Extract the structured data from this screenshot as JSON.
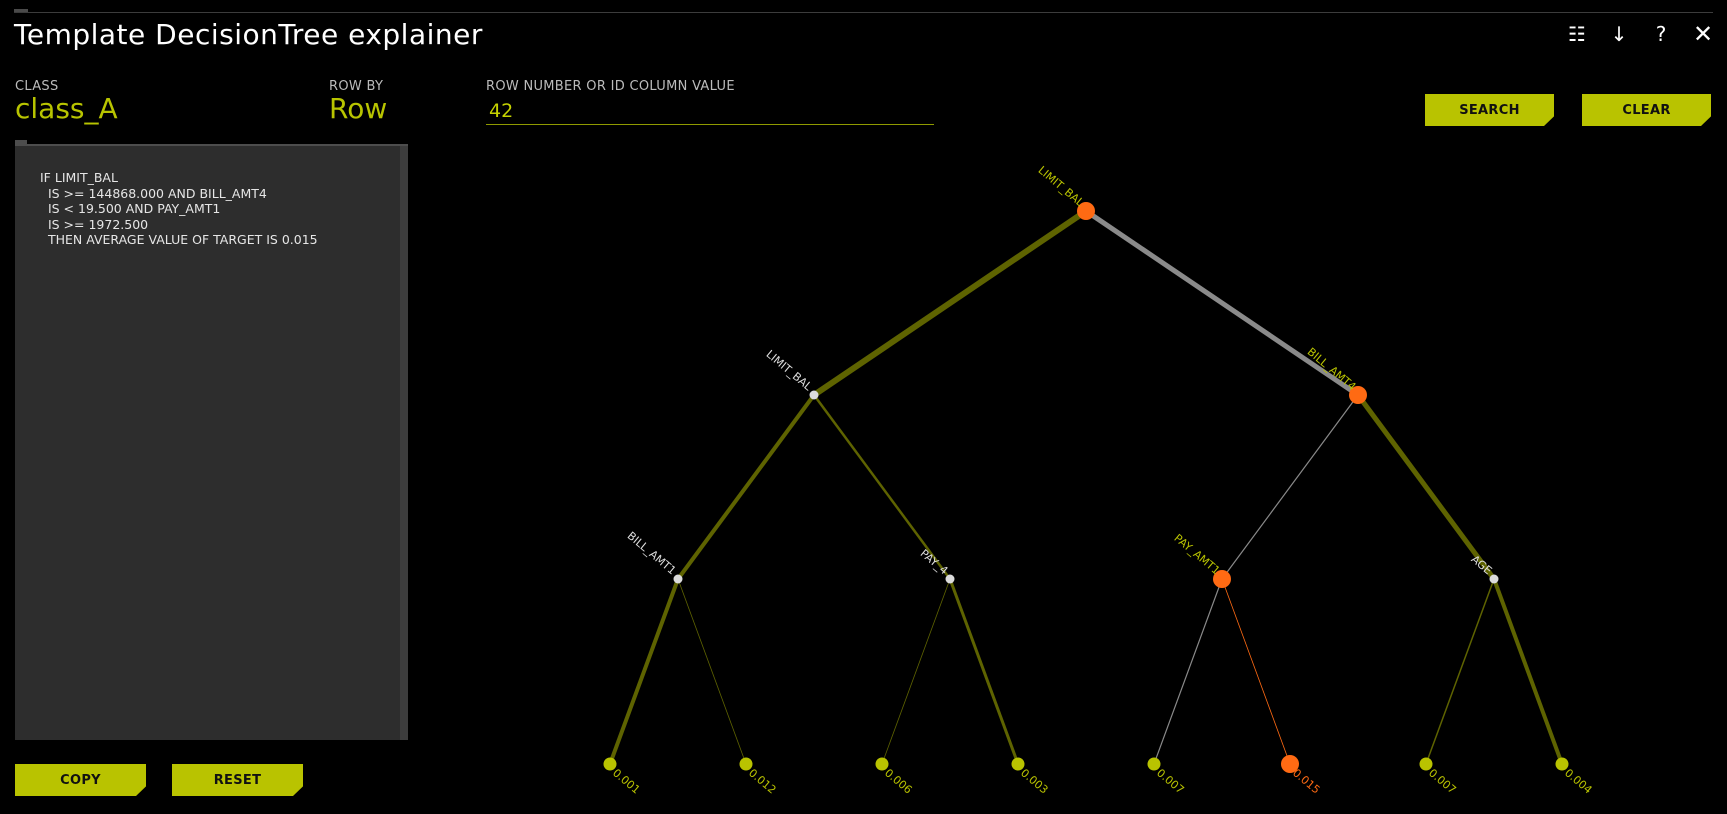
{
  "app": {
    "title": "Template DecisionTree explainer"
  },
  "toolbar": {
    "list_icon": "☷",
    "download_icon": "↓",
    "help_icon": "?",
    "close_icon": "✕"
  },
  "fields": {
    "class_label": "CLASS",
    "class_value": "class_A",
    "rowby_label": "ROW BY",
    "rowby_value": "Row",
    "row_label": "ROW NUMBER OR ID COLUMN VALUE",
    "row_value": "42"
  },
  "buttons": {
    "search": "SEARCH",
    "clear": "CLEAR",
    "copy": "COPY",
    "reset": "RESET"
  },
  "rules_text": "IF LIMIT_BAL\n  IS >= 144868.000 AND BILL_AMT4\n  IS < 19.500 AND PAY_AMT1\n  IS >= 1972.500\n  THEN AVERAGE VALUE OF TARGET IS 0.015",
  "colors": {
    "accent": "#b9c300",
    "path_highlight": "#ff6a13",
    "edge_dark": "#5e6300",
    "edge_gray": "#8a8a8a",
    "node_white": "#dcdcdc"
  },
  "tree": {
    "nodes": [
      {
        "id": "n0",
        "label": "LIMIT_BAL",
        "depth": 0,
        "pos": 0,
        "kind": "split",
        "highlight": true
      },
      {
        "id": "n1",
        "label": "LIMIT_BAL",
        "depth": 1,
        "pos": 0,
        "kind": "split",
        "highlight": false
      },
      {
        "id": "n2",
        "label": "BILL_AMT4",
        "depth": 1,
        "pos": 1,
        "kind": "split",
        "highlight": true
      },
      {
        "id": "n3",
        "label": "BILL_AMT1",
        "depth": 2,
        "pos": 0,
        "kind": "split",
        "highlight": false
      },
      {
        "id": "n4",
        "label": "PAY_4",
        "depth": 2,
        "pos": 1,
        "kind": "split",
        "highlight": false
      },
      {
        "id": "n5",
        "label": "PAY_AMT1",
        "depth": 2,
        "pos": 2,
        "kind": "split",
        "highlight": true
      },
      {
        "id": "n6",
        "label": "AGE",
        "depth": 2,
        "pos": 3,
        "kind": "split",
        "highlight": false
      },
      {
        "id": "l0",
        "label": "0.001",
        "depth": 3,
        "pos": 0,
        "kind": "leaf",
        "highlight": false
      },
      {
        "id": "l1",
        "label": "0.012",
        "depth": 3,
        "pos": 1,
        "kind": "leaf",
        "highlight": false
      },
      {
        "id": "l2",
        "label": "0.006",
        "depth": 3,
        "pos": 2,
        "kind": "leaf",
        "highlight": false
      },
      {
        "id": "l3",
        "label": "0.003",
        "depth": 3,
        "pos": 3,
        "kind": "leaf",
        "highlight": false
      },
      {
        "id": "l4",
        "label": "0.007",
        "depth": 3,
        "pos": 4,
        "kind": "leaf",
        "highlight": false
      },
      {
        "id": "l5",
        "label": "0.015",
        "depth": 3,
        "pos": 5,
        "kind": "leaf",
        "highlight": true
      },
      {
        "id": "l6",
        "label": "0.007",
        "depth": 3,
        "pos": 6,
        "kind": "leaf",
        "highlight": false
      },
      {
        "id": "l7",
        "label": "0.004",
        "depth": 3,
        "pos": 7,
        "kind": "leaf",
        "highlight": false
      }
    ],
    "edges": [
      {
        "from": "n0",
        "to": "n1",
        "weight": 6,
        "style": "dark"
      },
      {
        "from": "n0",
        "to": "n2",
        "weight": 5,
        "style": "gray"
      },
      {
        "from": "n1",
        "to": "n3",
        "weight": 4,
        "style": "dark"
      },
      {
        "from": "n1",
        "to": "n4",
        "weight": 2.5,
        "style": "dark"
      },
      {
        "from": "n2",
        "to": "n5",
        "weight": 1.2,
        "style": "gray"
      },
      {
        "from": "n2",
        "to": "n6",
        "weight": 5,
        "style": "dark"
      },
      {
        "from": "n3",
        "to": "l0",
        "weight": 4,
        "style": "dark"
      },
      {
        "from": "n3",
        "to": "l1",
        "weight": 0.8,
        "style": "dark"
      },
      {
        "from": "n4",
        "to": "l2",
        "weight": 0.8,
        "style": "dark"
      },
      {
        "from": "n4",
        "to": "l3",
        "weight": 3,
        "style": "dark"
      },
      {
        "from": "n5",
        "to": "l4",
        "weight": 1.2,
        "style": "gray"
      },
      {
        "from": "n5",
        "to": "l5",
        "weight": 0.8,
        "style": "orange"
      },
      {
        "from": "n6",
        "to": "l6",
        "weight": 1.5,
        "style": "dark"
      },
      {
        "from": "n6",
        "to": "l7",
        "weight": 4,
        "style": "dark"
      }
    ]
  }
}
